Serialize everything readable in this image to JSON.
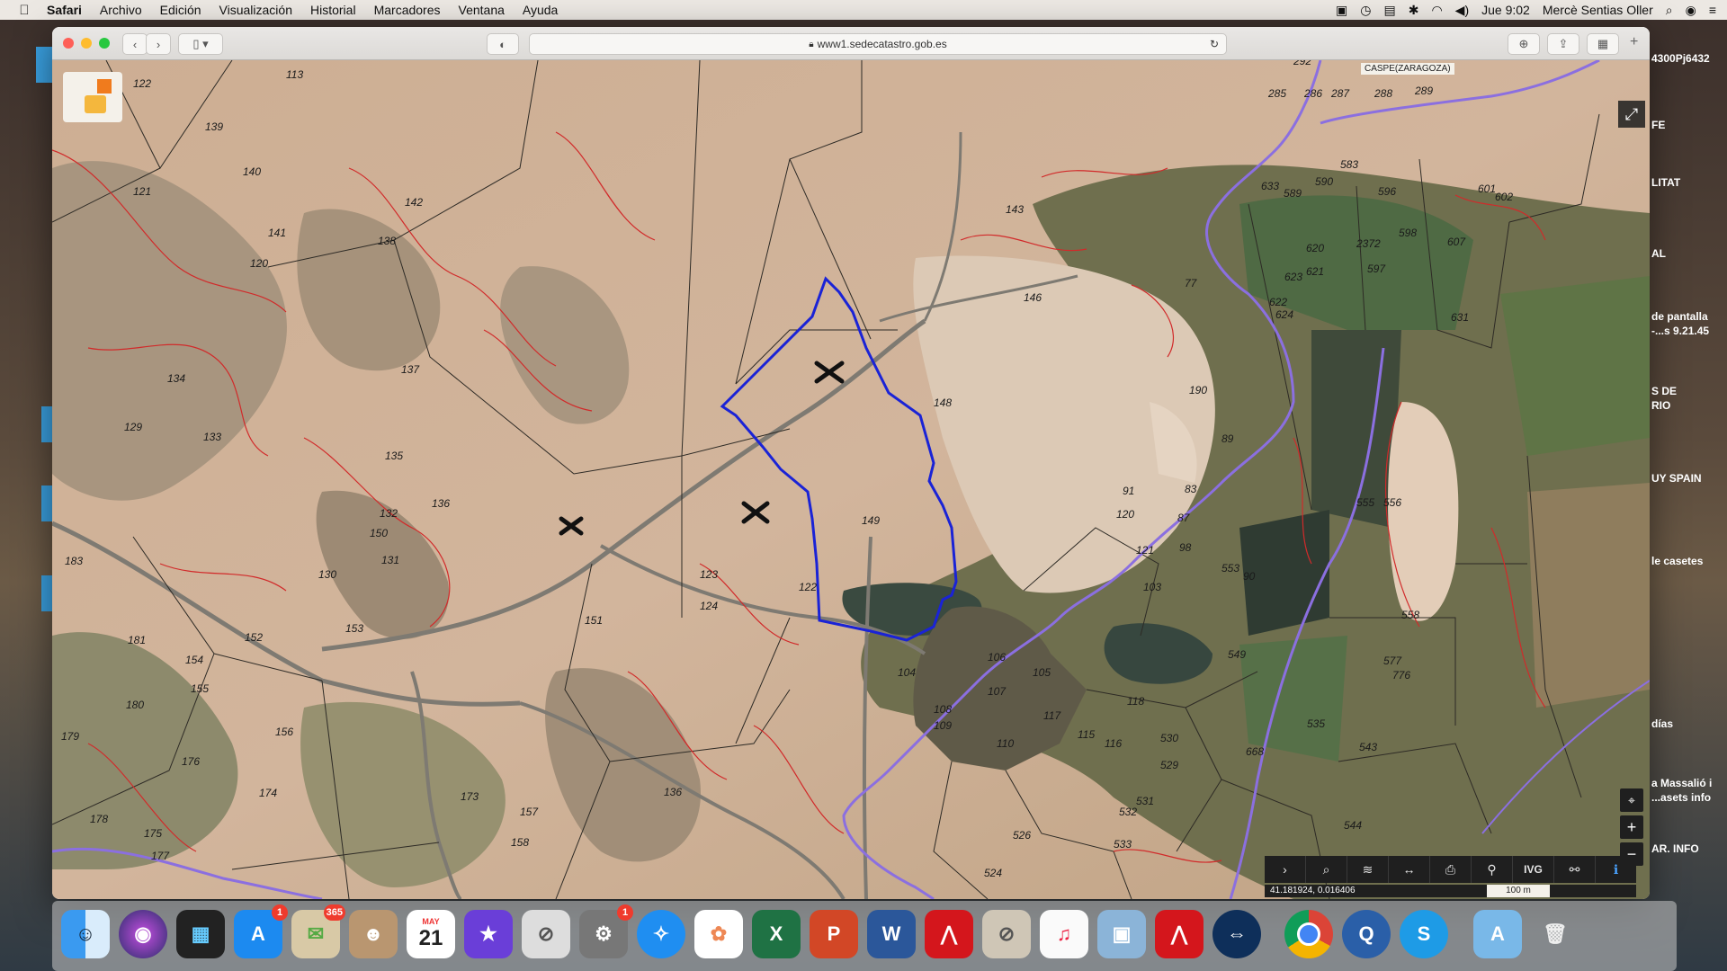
{
  "menubar": {
    "app": "Safari",
    "items": [
      "Archivo",
      "Edición",
      "Visualización",
      "Historial",
      "Marcadores",
      "Ventana",
      "Ayuda"
    ],
    "clock": "Jue 9:02",
    "user": "Mercè Sentias Oller"
  },
  "browser": {
    "url": "www1.sedecatastro.gob.es"
  },
  "map": {
    "municipality": "CASPE(ZARAGOZA)",
    "coordinates": "41.181924, 0.016406",
    "scale": "100 m",
    "toolbar": [
      "›",
      "⌕",
      "≋",
      "↔",
      "⎙",
      "⚲",
      "IVG",
      "⚯",
      "ℹ"
    ],
    "parcels": [
      {
        "n": "122"
      },
      {
        "n": "139"
      },
      {
        "n": "113"
      },
      {
        "n": "140"
      },
      {
        "n": "141"
      },
      {
        "n": "142"
      },
      {
        "n": "143"
      },
      {
        "n": "138"
      },
      {
        "n": "121"
      },
      {
        "n": "120"
      },
      {
        "n": "137"
      },
      {
        "n": "134"
      },
      {
        "n": "129"
      },
      {
        "n": "133"
      },
      {
        "n": "135"
      },
      {
        "n": "136"
      },
      {
        "n": "132"
      },
      {
        "n": "131"
      },
      {
        "n": "130"
      },
      {
        "n": "183"
      },
      {
        "n": "150"
      },
      {
        "n": "149"
      },
      {
        "n": "148"
      },
      {
        "n": "146"
      },
      {
        "n": "153"
      },
      {
        "n": "152"
      },
      {
        "n": "154"
      },
      {
        "n": "155"
      },
      {
        "n": "181"
      },
      {
        "n": "180"
      },
      {
        "n": "179"
      },
      {
        "n": "176"
      },
      {
        "n": "156"
      },
      {
        "n": "151"
      },
      {
        "n": "178"
      },
      {
        "n": "174"
      },
      {
        "n": "173"
      },
      {
        "n": "175"
      },
      {
        "n": "177"
      },
      {
        "n": "157"
      },
      {
        "n": "158"
      },
      {
        "n": "136"
      },
      {
        "n": "124"
      },
      {
        "n": "123"
      },
      {
        "n": "122"
      },
      {
        "n": "104"
      },
      {
        "n": "106"
      },
      {
        "n": "105"
      },
      {
        "n": "107"
      },
      {
        "n": "108"
      },
      {
        "n": "109"
      },
      {
        "n": "110"
      },
      {
        "n": "115"
      },
      {
        "n": "116"
      },
      {
        "n": "117"
      },
      {
        "n": "118"
      },
      {
        "n": "120"
      },
      {
        "n": "121"
      },
      {
        "n": "103"
      },
      {
        "n": "98"
      },
      {
        "n": "553"
      },
      {
        "n": "549"
      },
      {
        "n": "555"
      },
      {
        "n": "556"
      },
      {
        "n": "558"
      },
      {
        "n": "577"
      },
      {
        "n": "776"
      },
      {
        "n": "535"
      },
      {
        "n": "543"
      },
      {
        "n": "668"
      },
      {
        "n": "530"
      },
      {
        "n": "529"
      },
      {
        "n": "531"
      },
      {
        "n": "532"
      },
      {
        "n": "533"
      },
      {
        "n": "526"
      },
      {
        "n": "524"
      },
      {
        "n": "90"
      },
      {
        "n": "91"
      },
      {
        "n": "89"
      },
      {
        "n": "87"
      },
      {
        "n": "83"
      },
      {
        "n": "190"
      },
      {
        "n": "77"
      },
      {
        "n": "620"
      },
      {
        "n": "621"
      },
      {
        "n": "622"
      },
      {
        "n": "624"
      },
      {
        "n": "623"
      },
      {
        "n": "597"
      },
      {
        "n": "598"
      },
      {
        "n": "607"
      },
      {
        "n": "2372"
      },
      {
        "n": "631"
      },
      {
        "n": "590"
      },
      {
        "n": "583"
      },
      {
        "n": "602"
      },
      {
        "n": "601"
      },
      {
        "n": "596"
      },
      {
        "n": "292"
      },
      {
        "n": "285"
      },
      {
        "n": "286"
      },
      {
        "n": "287"
      },
      {
        "n": "288"
      },
      {
        "n": "289"
      },
      {
        "n": "633"
      },
      {
        "n": "589"
      },
      {
        "n": "544"
      }
    ]
  },
  "desktop_right": [
    {
      "text": "4300Pj6432"
    },
    {
      "text": "FE"
    },
    {
      "text": "LITAT"
    },
    {
      "text": "AL"
    },
    {
      "text": "de pantalla"
    },
    {
      "text": "-...s 9.21.45"
    },
    {
      "text": "S DE"
    },
    {
      "text": "RIO"
    },
    {
      "text": "UY SPAIN"
    },
    {
      "text": "le casetes"
    },
    {
      "text": "días"
    },
    {
      "text": "a Massalió i"
    },
    {
      "text": "...asets info"
    },
    {
      "text": "AR. INFO"
    }
  ],
  "dock": {
    "badges": {
      "appstore": "1",
      "mail": "365",
      "prefs": "1"
    },
    "calendar_month": "MAY",
    "calendar_day": "21"
  }
}
